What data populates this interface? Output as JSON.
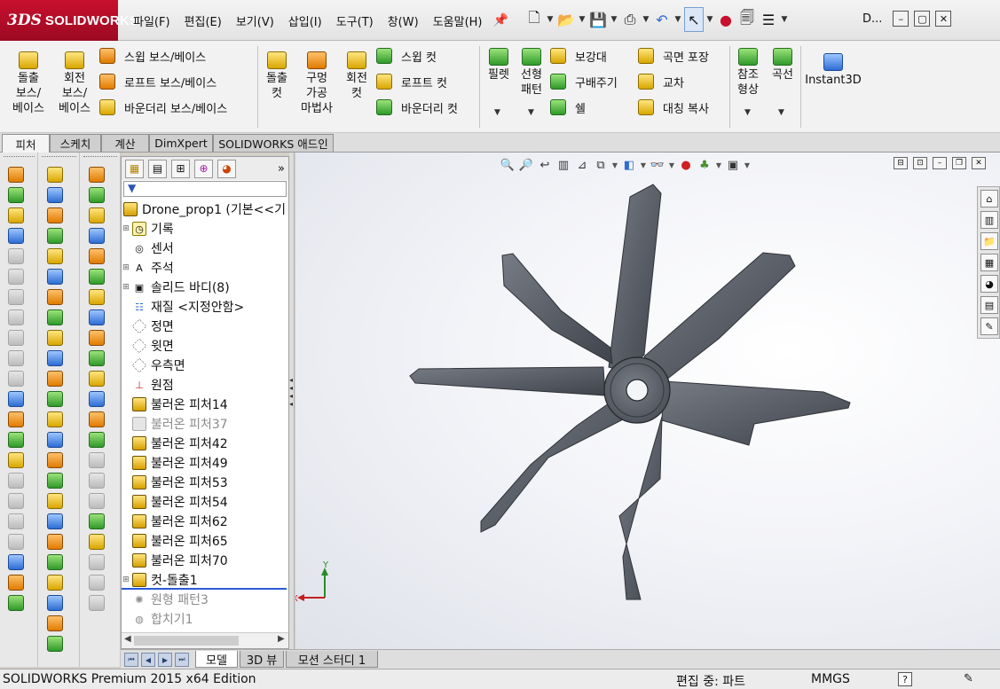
{
  "app": {
    "logo_prefix": "3DS",
    "logo_name": "SOLIDWORKS"
  },
  "menu": [
    "파일(F)",
    "편집(E)",
    "보기(V)",
    "삽입(I)",
    "도구(T)",
    "창(W)",
    "도움말(H)"
  ],
  "title_short": "D...",
  "ribbon": {
    "extrude_boss": "돌출\n보스/\n베이스",
    "revolve_boss": "회전\n보스/\n베이스",
    "sweep_boss": "스윕 보스/베이스",
    "loft_boss": "로프트 보스/베이스",
    "boundary_boss": "바운더리 보스/베이스",
    "extrude_cut": "돌출\n컷",
    "hole_wizard": "구멍\n가공\n마법사",
    "revolve_cut": "회전\n컷",
    "sweep_cut": "스윕 컷",
    "loft_cut": "로프트 컷",
    "boundary_cut": "바운더리 컷",
    "fillet": "필렛",
    "linear_pattern": "선형\n패턴",
    "rib": "보강대",
    "draft": "구배주기",
    "shell": "쉘",
    "wrap": "곡면 포장",
    "intersect": "교차",
    "mirror": "대칭 복사",
    "ref_geometry": "참조\n형상",
    "curves": "곡선",
    "instant3d": "Instant3D"
  },
  "tabs": [
    "피처",
    "스케치",
    "계산",
    "DimXpert",
    "SOLIDWORKS 애드인"
  ],
  "feature_tree": {
    "root": "Drone_prop1  (기본<<기",
    "items": [
      {
        "label": "기록",
        "type": "hist",
        "exp": true,
        "dim": false
      },
      {
        "label": "센서",
        "type": "sensor",
        "exp": false,
        "dim": false
      },
      {
        "label": "주석",
        "type": "note",
        "exp": true,
        "dim": false
      },
      {
        "label": "솔리드 바디(8)",
        "type": "body",
        "exp": true,
        "dim": false
      },
      {
        "label": "재질 <지정안함>",
        "type": "mat",
        "exp": false,
        "dim": false
      },
      {
        "label": "정면",
        "type": "plane",
        "exp": false,
        "dim": false
      },
      {
        "label": "윗면",
        "type": "plane",
        "exp": false,
        "dim": false
      },
      {
        "label": "우측면",
        "type": "plane",
        "exp": false,
        "dim": false
      },
      {
        "label": "원점",
        "type": "origin",
        "exp": false,
        "dim": false
      },
      {
        "label": "불러온 피처14",
        "type": "feat",
        "exp": false,
        "dim": false
      },
      {
        "label": "불러온 피처37",
        "type": "featd",
        "exp": false,
        "dim": true
      },
      {
        "label": "불러온 피처42",
        "type": "feat",
        "exp": false,
        "dim": false
      },
      {
        "label": "불러온 피처49",
        "type": "feat",
        "exp": false,
        "dim": false
      },
      {
        "label": "불러온 피처53",
        "type": "feat",
        "exp": false,
        "dim": false
      },
      {
        "label": "불러온 피처54",
        "type": "feat",
        "exp": false,
        "dim": false
      },
      {
        "label": "불러온 피처62",
        "type": "feat",
        "exp": false,
        "dim": false
      },
      {
        "label": "불러온 피처65",
        "type": "feat",
        "exp": false,
        "dim": false
      },
      {
        "label": "불러온 피처70",
        "type": "feat",
        "exp": false,
        "dim": false
      },
      {
        "label": "컷-돌출1",
        "type": "feat",
        "exp": true,
        "dim": false
      },
      {
        "label": "원형 패턴3",
        "type": "pattern",
        "exp": false,
        "dim": true
      },
      {
        "label": "합치기1",
        "type": "combine",
        "exp": false,
        "dim": true
      }
    ]
  },
  "model_tabs": [
    "모델",
    "3D 뷰",
    "모션 스터디 1"
  ],
  "status": {
    "product": "SOLIDWORKS Premium 2015 x64 Edition",
    "mode": "편집 중: 파트",
    "units": "MMGS",
    "help": "?"
  },
  "triad": {
    "y": "Y",
    "x": "X"
  },
  "colors": {
    "brand_red": "#c8102e",
    "part_gray": "#5b5f68",
    "selection_blue": "#2a5bd7"
  }
}
